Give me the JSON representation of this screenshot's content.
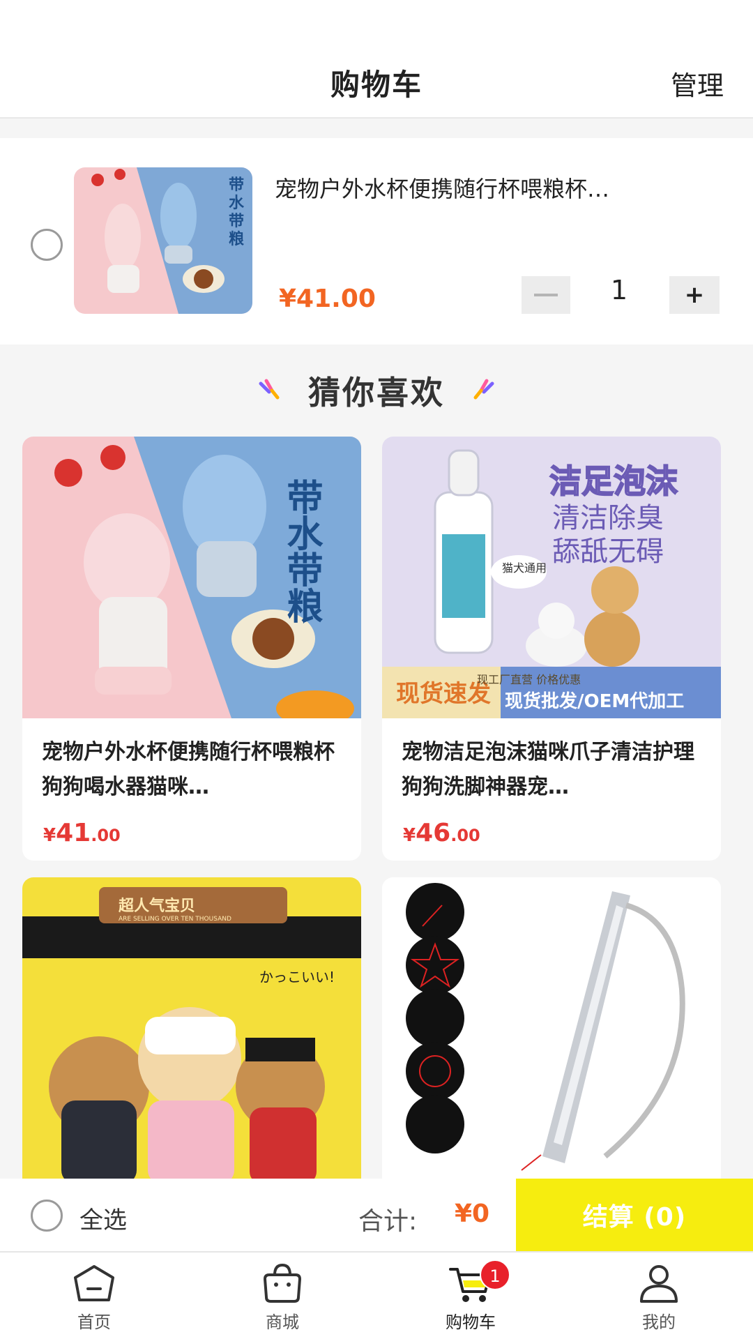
{
  "header": {
    "title": "购物车",
    "manage_label": "管理"
  },
  "cart_item": {
    "title": "宠物户外水杯便携随行杯喂粮杯…",
    "price": "¥41.00",
    "quantity": "1",
    "thumb_text": "带水带粮"
  },
  "recommend": {
    "heading": "猜你喜欢",
    "products": [
      {
        "name": "宠物户外水杯便携随行杯喂粮杯狗狗喝水器猫咪…",
        "currency": "¥",
        "price_int": "41",
        "price_dec": ".00",
        "img_text": "带水带粮"
      },
      {
        "name": "宠物洁足泡沫猫咪爪子清洁护理狗狗洗脚神器宠…",
        "currency": "¥",
        "price_int": "46",
        "price_dec": ".00",
        "img_title": "洁足泡沫",
        "img_line1": "清洁除臭",
        "img_line2": "舔舐无碍",
        "img_badge": "猫犬通用",
        "img_promo": "现货速发",
        "img_factory": "现工厂直营 价格优惠",
        "img_wholesale": "现货批发/OEM代加工"
      },
      {
        "img_banner": "超人气宝贝",
        "img_banner_sub": "ARE SELLING OVER TEN THOUSAND",
        "img_jp": "かっこいい!"
      },
      {
        "img_alt": "laser-pointer"
      }
    ]
  },
  "checkout": {
    "select_all_label": "全选",
    "total_label": "合计:",
    "total_value": "¥0",
    "settle_label": "结算 (0)"
  },
  "tabbar": {
    "tabs": [
      {
        "label": "首页"
      },
      {
        "label": "商城"
      },
      {
        "label": "购物车",
        "badge": "1"
      },
      {
        "label": "我的"
      }
    ]
  },
  "colors": {
    "accent": "#f26522",
    "price_red": "#e53935",
    "settle_yellow": "#f6ed0f",
    "badge_red": "#e8202a"
  }
}
